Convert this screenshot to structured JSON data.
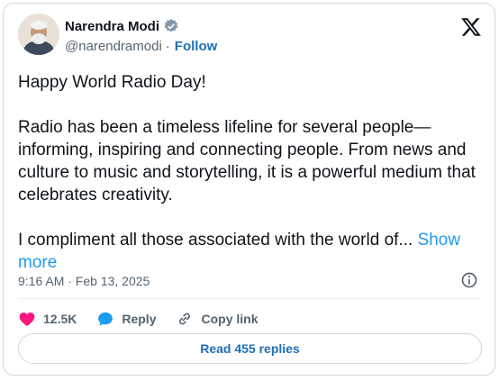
{
  "author": {
    "name": "Narendra Modi",
    "handle": "@narendramodi",
    "follow_label": "Follow",
    "separator": "·"
  },
  "tweet": {
    "line1": "Happy World Radio Day!",
    "para2": "Radio has been a timeless lifeline for several people—informing, inspiring and connecting people. From news and culture to music and storytelling, it is a powerful medium that celebrates creativity.",
    "para3": "I compliment all those associated with the world of...",
    "show_more": "Show more"
  },
  "meta": {
    "timestamp": "9:16 AM · Feb 13, 2025"
  },
  "actions": {
    "likes": "12.5K",
    "reply": "Reply",
    "copy_link": "Copy link"
  },
  "read_replies": "Read 455 replies",
  "colors": {
    "accent": "#1d9bf0",
    "link_dark": "#1d6fb8",
    "like": "#f91880",
    "muted": "#536471",
    "border": "#cfd9de"
  }
}
